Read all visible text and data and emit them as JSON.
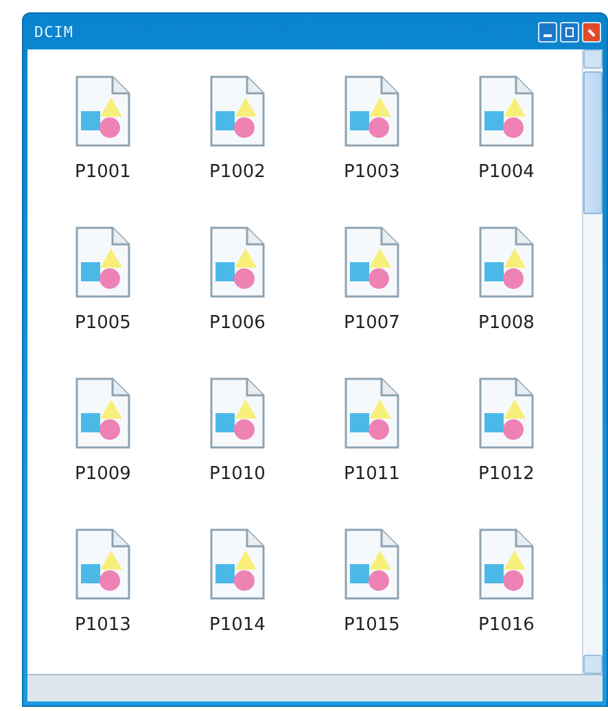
{
  "window": {
    "title": "DCIM"
  },
  "files": [
    {
      "name": "P1001"
    },
    {
      "name": "P1002"
    },
    {
      "name": "P1003"
    },
    {
      "name": "P1004"
    },
    {
      "name": "P1005"
    },
    {
      "name": "P1006"
    },
    {
      "name": "P1007"
    },
    {
      "name": "P1008"
    },
    {
      "name": "P1009"
    },
    {
      "name": "P1010"
    },
    {
      "name": "P1011"
    },
    {
      "name": "P1012"
    },
    {
      "name": "P1013"
    },
    {
      "name": "P1014"
    },
    {
      "name": "P1015"
    },
    {
      "name": "P1016"
    }
  ]
}
